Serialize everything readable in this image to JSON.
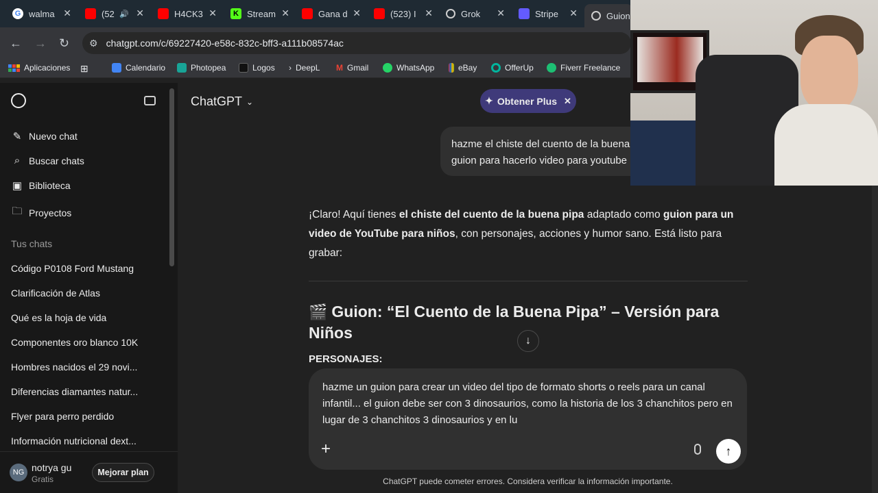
{
  "tabs": [
    {
      "label": "walma",
      "color": "#ffffff",
      "icon": "google-icon"
    },
    {
      "label": "(52",
      "color": "#ff0000",
      "icon": "youtube-icon"
    },
    {
      "label": "H4CK3",
      "color": "#ff0000",
      "icon": "youtube-icon"
    },
    {
      "label": "Stream",
      "color": "#53fc18",
      "icon": "kick-icon"
    },
    {
      "label": "Gana d",
      "color": "#ff0000",
      "icon": "youtube-icon"
    },
    {
      "label": "(523) I",
      "color": "#ff0000",
      "icon": "youtube-icon"
    },
    {
      "label": "Grok",
      "color": "#cfcfcf",
      "icon": "grok-icon"
    },
    {
      "label": "Stripe",
      "color": "#635bff",
      "icon": "stripe-icon"
    },
    {
      "label": "Guion",
      "color": "#cfcfcf",
      "icon": "chatgpt-icon"
    }
  ],
  "address": {
    "url": "chatgpt.com/c/69227420-e58c-832c-bff3-a111b08574ac"
  },
  "bookmarks": [
    "Aplicaciones",
    "Calendario",
    "Photopea",
    "Logos",
    "DeepL",
    "Gmail",
    "WhatsApp",
    "eBay",
    "OfferUp",
    "Fiverr Freelance"
  ],
  "sidebar": {
    "nav": [
      "Nuevo chat",
      "Buscar chats",
      "Biblioteca",
      "Proyectos"
    ],
    "section_title": "Tus chats",
    "chats": [
      "Código P0108 Ford Mustang",
      "Clarificación de Atlas",
      "Qué es la hoja de vida",
      "Componentes oro blanco 10K",
      "Hombres nacidos el 29 novi...",
      "Diferencias diamantes natur...",
      "Flyer para perro perdido",
      "Información nutricional dext..."
    ],
    "user": {
      "initials": "NG",
      "name": "notrya gu",
      "plan": "Gratis",
      "upgrade": "Mejorar plan"
    }
  },
  "header": {
    "model": "ChatGPT",
    "plus_button": "Obtener Plus"
  },
  "conversation": {
    "user_message_line1": "hazme el chiste del cuento de la buena pipa como",
    "user_message_line2": "guion para hacerlo video para youtube para niños",
    "resp_1": "¡Claro! Aquí tienes ",
    "resp_2": "el chiste del cuento de la buena pipa",
    "resp_3": " adaptado como ",
    "resp_4": "guion para un video de YouTube para niños",
    "resp_5": ", con personajes, acciones y humor sano. Está listo para grabar:",
    "heading_emoji": "🎬",
    "heading": "Guion: “El Cuento de la Buena Pipa” – Versión para Niños",
    "personajes": "PERSONAJES:"
  },
  "composer": {
    "text": "hazme un guion para crear un video del tipo de formato shorts o reels para un canal infantil... el guion debe ser con 3 dinosaurios, como la historia de los 3 chanchitos pero en lugar de 3 chanchitos 3 dinosaurios y en lu"
  },
  "disclaimer": "ChatGPT puede cometer errores. Considera verificar la información importante."
}
